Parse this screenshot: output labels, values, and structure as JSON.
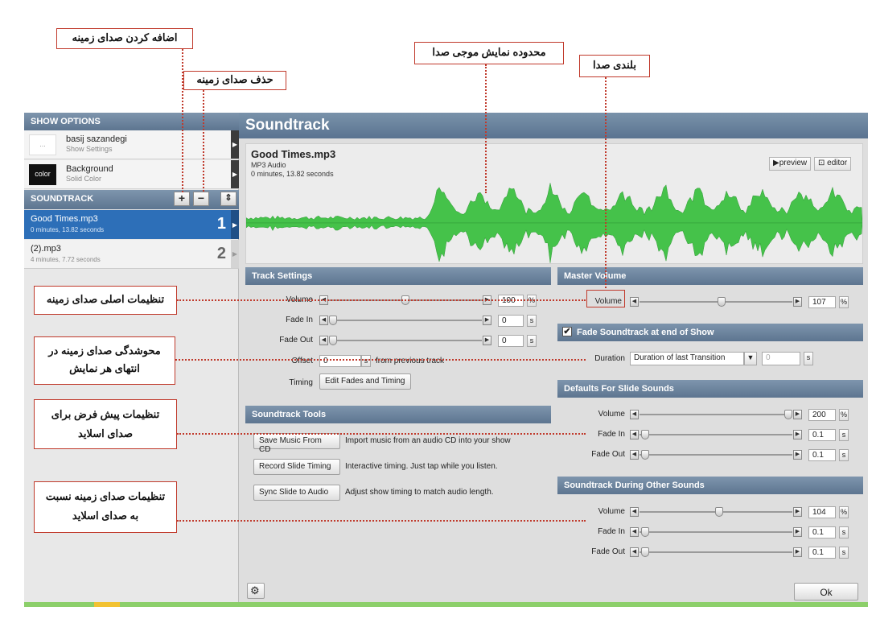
{
  "sidebar": {
    "show_options_title": "SHOW OPTIONS",
    "show_items": [
      {
        "title": "basij sazandegi",
        "subtitle": "Show Settings",
        "thumb": "..."
      },
      {
        "title": "Background",
        "subtitle": "Solid Color",
        "thumb": "color"
      }
    ],
    "soundtrack_title": "SOUNDTRACK",
    "buttons": {
      "add": "+",
      "remove": "−",
      "reorder": "⇕"
    },
    "tracks": [
      {
        "name": "Good Times.mp3",
        "duration": "0 minutes, 13.82 seconds",
        "number": "1",
        "selected": true
      },
      {
        "name": "(2).mp3",
        "duration": "4 minutes, 7.72 seconds",
        "number": "2",
        "selected": false
      }
    ]
  },
  "main": {
    "title": "Soundtrack",
    "file": {
      "name": "Good Times.mp3",
      "type": "MP3 Audio",
      "duration": "0 minutes, 13.82 seconds"
    },
    "preview_label": "▶preview",
    "editor_label": "⊡ editor",
    "track_settings": {
      "title": "Track Settings",
      "volume_label": "Volume",
      "volume_value": "100",
      "volume_unit": "%",
      "volume_level": 0.5,
      "fade_in_label": "Fade In",
      "fade_in_value": "0",
      "fade_out_label": "Fade Out",
      "fade_out_value": "0",
      "seconds_unit": "s",
      "offset_label": "Offset",
      "offset_value": "0",
      "offset_suffix": "from previous track",
      "timing_label": "Timing",
      "timing_button": "Edit Fades and Timing"
    },
    "soundtrack_tools": {
      "title": "Soundtrack Tools",
      "tools": [
        {
          "button": "Save Music From CD",
          "desc": "Import music from an audio CD into your show"
        },
        {
          "button": "Record Slide Timing",
          "desc": "Interactive timing. Just tap while you listen."
        },
        {
          "button": "Sync Slide to Audio",
          "desc": "Adjust show timing to match audio length."
        }
      ]
    },
    "master_volume": {
      "title": "Master Volume",
      "volume_label": "Volume",
      "volume_value": "107",
      "volume_unit": "%",
      "volume_level": 0.54
    },
    "fade_soundtrack": {
      "title": "Fade Soundtrack at end of Show",
      "checked": true,
      "duration_label": "Duration",
      "duration_value": "Duration of last Transition",
      "duration_number": "0",
      "duration_unit": "s"
    },
    "defaults_slide_sounds": {
      "title": "Defaults For Slide Sounds",
      "volume_label": "Volume",
      "volume_value": "200",
      "volume_unit": "%",
      "volume_level": 1.0,
      "fade_in_label": "Fade In",
      "fade_in_value": "0.1",
      "fade_in_unit": "s",
      "fade_out_label": "Fade Out",
      "fade_out_value": "0.1",
      "fade_out_unit": "s"
    },
    "during_other_sounds": {
      "title": "Soundtrack During Other Sounds",
      "volume_label": "Volume",
      "volume_value": "104",
      "volume_unit": "%",
      "volume_level": 0.52,
      "fade_in_label": "Fade In",
      "fade_in_value": "0.1",
      "fade_in_unit": "s",
      "fade_out_label": "Fade Out",
      "fade_out_value": "0.1",
      "fade_out_unit": "s"
    },
    "ok_label": "Ok"
  },
  "annotations": {
    "add_sound": "اضافه کردن صدای زمینه",
    "remove_sound": "حذف صدای زمینه",
    "waveform_area": "محدوده نمایش موجی صدا",
    "volume": "بلندی صدا",
    "main_settings": "تنظیمات اصلی صدای زمینه",
    "fade_line1": "محوشدگی صدای زمینه در",
    "fade_line2": "انتهای هر نمایش",
    "defaults_line1": "تنظیمات پیش فرض برای",
    "defaults_line2": "صدای اسلاید",
    "relative_line1": "تنظیمات صدای زمینه نسبت",
    "relative_line2": "به صدای اسلاید"
  },
  "colors": {
    "header_blue": "#6a829c",
    "selected_row": "#2d6fb8",
    "waveform_green": "#45c24a",
    "annotation_red": "#c0392b"
  }
}
